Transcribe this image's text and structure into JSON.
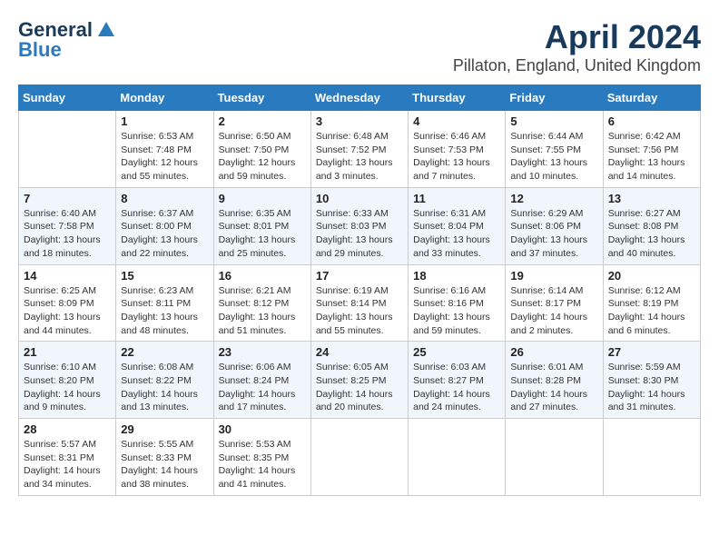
{
  "header": {
    "logo_line1": "General",
    "logo_line2": "Blue",
    "title": "April 2024",
    "subtitle": "Pillaton, England, United Kingdom"
  },
  "days_of_week": [
    "Sunday",
    "Monday",
    "Tuesday",
    "Wednesday",
    "Thursday",
    "Friday",
    "Saturday"
  ],
  "weeks": [
    [
      {
        "day": "",
        "content": ""
      },
      {
        "day": "1",
        "content": "Sunrise: 6:53 AM\nSunset: 7:48 PM\nDaylight: 12 hours\nand 55 minutes."
      },
      {
        "day": "2",
        "content": "Sunrise: 6:50 AM\nSunset: 7:50 PM\nDaylight: 12 hours\nand 59 minutes."
      },
      {
        "day": "3",
        "content": "Sunrise: 6:48 AM\nSunset: 7:52 PM\nDaylight: 13 hours\nand 3 minutes."
      },
      {
        "day": "4",
        "content": "Sunrise: 6:46 AM\nSunset: 7:53 PM\nDaylight: 13 hours\nand 7 minutes."
      },
      {
        "day": "5",
        "content": "Sunrise: 6:44 AM\nSunset: 7:55 PM\nDaylight: 13 hours\nand 10 minutes."
      },
      {
        "day": "6",
        "content": "Sunrise: 6:42 AM\nSunset: 7:56 PM\nDaylight: 13 hours\nand 14 minutes."
      }
    ],
    [
      {
        "day": "7",
        "content": "Sunrise: 6:40 AM\nSunset: 7:58 PM\nDaylight: 13 hours\nand 18 minutes."
      },
      {
        "day": "8",
        "content": "Sunrise: 6:37 AM\nSunset: 8:00 PM\nDaylight: 13 hours\nand 22 minutes."
      },
      {
        "day": "9",
        "content": "Sunrise: 6:35 AM\nSunset: 8:01 PM\nDaylight: 13 hours\nand 25 minutes."
      },
      {
        "day": "10",
        "content": "Sunrise: 6:33 AM\nSunset: 8:03 PM\nDaylight: 13 hours\nand 29 minutes."
      },
      {
        "day": "11",
        "content": "Sunrise: 6:31 AM\nSunset: 8:04 PM\nDaylight: 13 hours\nand 33 minutes."
      },
      {
        "day": "12",
        "content": "Sunrise: 6:29 AM\nSunset: 8:06 PM\nDaylight: 13 hours\nand 37 minutes."
      },
      {
        "day": "13",
        "content": "Sunrise: 6:27 AM\nSunset: 8:08 PM\nDaylight: 13 hours\nand 40 minutes."
      }
    ],
    [
      {
        "day": "14",
        "content": "Sunrise: 6:25 AM\nSunset: 8:09 PM\nDaylight: 13 hours\nand 44 minutes."
      },
      {
        "day": "15",
        "content": "Sunrise: 6:23 AM\nSunset: 8:11 PM\nDaylight: 13 hours\nand 48 minutes."
      },
      {
        "day": "16",
        "content": "Sunrise: 6:21 AM\nSunset: 8:12 PM\nDaylight: 13 hours\nand 51 minutes."
      },
      {
        "day": "17",
        "content": "Sunrise: 6:19 AM\nSunset: 8:14 PM\nDaylight: 13 hours\nand 55 minutes."
      },
      {
        "day": "18",
        "content": "Sunrise: 6:16 AM\nSunset: 8:16 PM\nDaylight: 13 hours\nand 59 minutes."
      },
      {
        "day": "19",
        "content": "Sunrise: 6:14 AM\nSunset: 8:17 PM\nDaylight: 14 hours\nand 2 minutes."
      },
      {
        "day": "20",
        "content": "Sunrise: 6:12 AM\nSunset: 8:19 PM\nDaylight: 14 hours\nand 6 minutes."
      }
    ],
    [
      {
        "day": "21",
        "content": "Sunrise: 6:10 AM\nSunset: 8:20 PM\nDaylight: 14 hours\nand 9 minutes."
      },
      {
        "day": "22",
        "content": "Sunrise: 6:08 AM\nSunset: 8:22 PM\nDaylight: 14 hours\nand 13 minutes."
      },
      {
        "day": "23",
        "content": "Sunrise: 6:06 AM\nSunset: 8:24 PM\nDaylight: 14 hours\nand 17 minutes."
      },
      {
        "day": "24",
        "content": "Sunrise: 6:05 AM\nSunset: 8:25 PM\nDaylight: 14 hours\nand 20 minutes."
      },
      {
        "day": "25",
        "content": "Sunrise: 6:03 AM\nSunset: 8:27 PM\nDaylight: 14 hours\nand 24 minutes."
      },
      {
        "day": "26",
        "content": "Sunrise: 6:01 AM\nSunset: 8:28 PM\nDaylight: 14 hours\nand 27 minutes."
      },
      {
        "day": "27",
        "content": "Sunrise: 5:59 AM\nSunset: 8:30 PM\nDaylight: 14 hours\nand 31 minutes."
      }
    ],
    [
      {
        "day": "28",
        "content": "Sunrise: 5:57 AM\nSunset: 8:31 PM\nDaylight: 14 hours\nand 34 minutes."
      },
      {
        "day": "29",
        "content": "Sunrise: 5:55 AM\nSunset: 8:33 PM\nDaylight: 14 hours\nand 38 minutes."
      },
      {
        "day": "30",
        "content": "Sunrise: 5:53 AM\nSunset: 8:35 PM\nDaylight: 14 hours\nand 41 minutes."
      },
      {
        "day": "",
        "content": ""
      },
      {
        "day": "",
        "content": ""
      },
      {
        "day": "",
        "content": ""
      },
      {
        "day": "",
        "content": ""
      }
    ]
  ]
}
